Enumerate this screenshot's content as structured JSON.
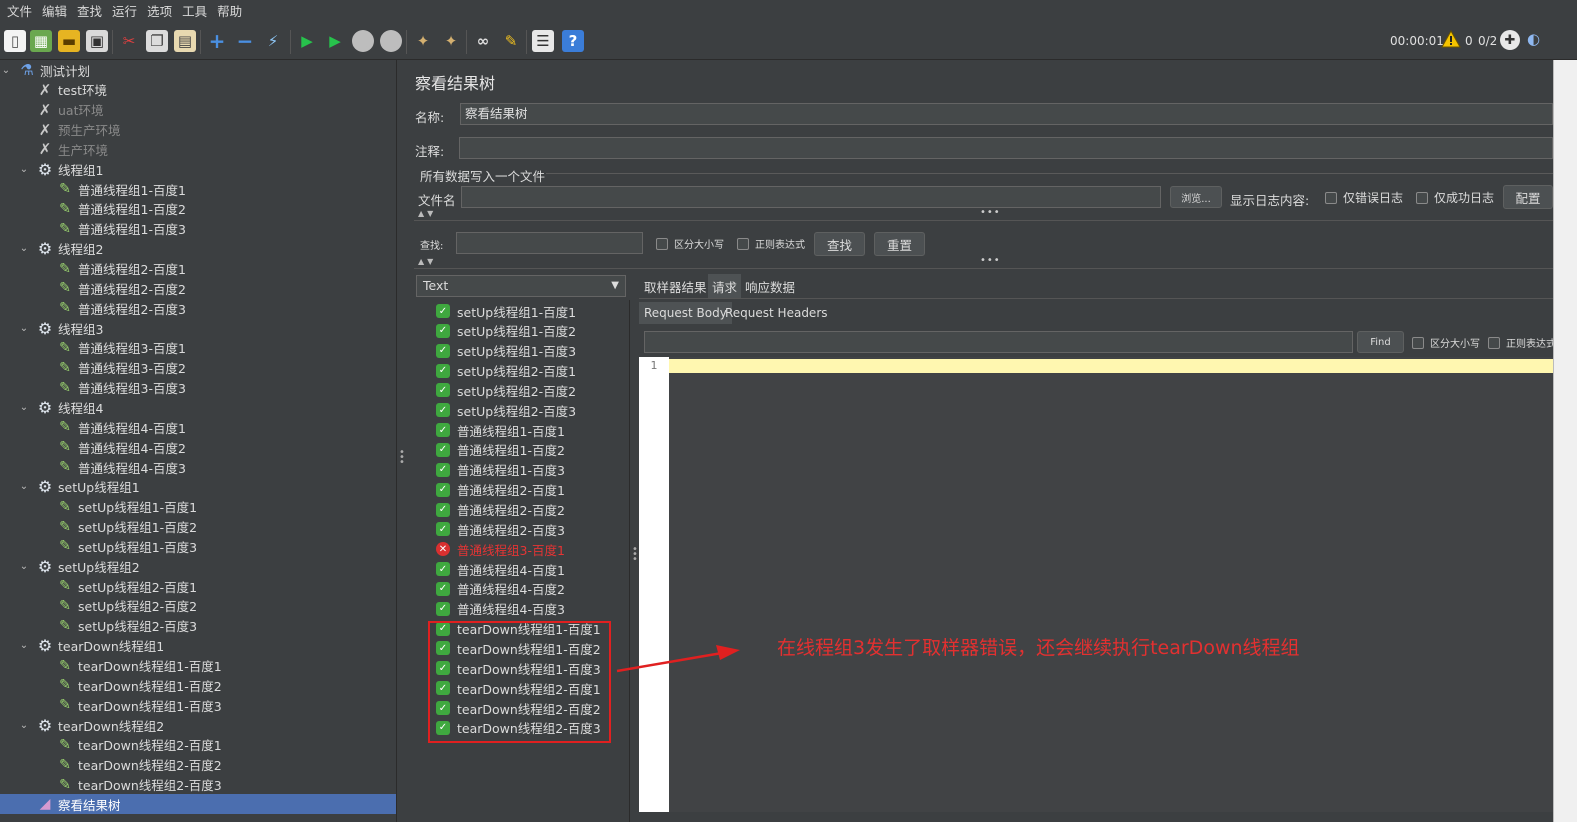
{
  "menu": [
    "文件",
    "编辑",
    "查找",
    "运行",
    "选项",
    "工具",
    "帮助"
  ],
  "status": {
    "time": "00:00:01",
    "error_count": "0",
    "threads": "0/2"
  },
  "tree": [
    {
      "label": "测试计划",
      "icon": "flask-icon",
      "level": 0,
      "expand": true
    },
    {
      "label": "test环境",
      "icon": "wrench-icon",
      "level": 1
    },
    {
      "label": "uat环境",
      "icon": "wrench-icon",
      "level": 1,
      "disabled": true
    },
    {
      "label": "预生产环境",
      "icon": "wrench-icon",
      "level": 1,
      "disabled": true
    },
    {
      "label": "生产环境",
      "icon": "wrench-icon",
      "level": 1,
      "disabled": true
    },
    {
      "label": "线程组1",
      "icon": "gear-icon",
      "level": 1,
      "expand": true
    },
    {
      "label": "普通线程组1-百度1",
      "icon": "pen-icon",
      "level": 2
    },
    {
      "label": "普通线程组1-百度2",
      "icon": "pen-icon",
      "level": 2
    },
    {
      "label": "普通线程组1-百度3",
      "icon": "pen-icon",
      "level": 2
    },
    {
      "label": "线程组2",
      "icon": "gear-icon",
      "level": 1,
      "expand": true
    },
    {
      "label": "普通线程组2-百度1",
      "icon": "pen-icon",
      "level": 2
    },
    {
      "label": "普通线程组2-百度2",
      "icon": "pen-icon",
      "level": 2
    },
    {
      "label": "普通线程组2-百度3",
      "icon": "pen-icon",
      "level": 2
    },
    {
      "label": "线程组3",
      "icon": "gear-icon",
      "level": 1,
      "expand": true
    },
    {
      "label": "普通线程组3-百度1",
      "icon": "pen-icon",
      "level": 2
    },
    {
      "label": "普通线程组3-百度2",
      "icon": "pen-icon",
      "level": 2
    },
    {
      "label": "普通线程组3-百度3",
      "icon": "pen-icon",
      "level": 2
    },
    {
      "label": "线程组4",
      "icon": "gear-icon",
      "level": 1,
      "expand": true
    },
    {
      "label": "普通线程组4-百度1",
      "icon": "pen-icon",
      "level": 2
    },
    {
      "label": "普通线程组4-百度2",
      "icon": "pen-icon",
      "level": 2
    },
    {
      "label": "普通线程组4-百度3",
      "icon": "pen-icon",
      "level": 2
    },
    {
      "label": "setUp线程组1",
      "icon": "gear-icon",
      "level": 1,
      "expand": true
    },
    {
      "label": "setUp线程组1-百度1",
      "icon": "pen-icon",
      "level": 2
    },
    {
      "label": "setUp线程组1-百度2",
      "icon": "pen-icon",
      "level": 2
    },
    {
      "label": "setUp线程组1-百度3",
      "icon": "pen-icon",
      "level": 2
    },
    {
      "label": "setUp线程组2",
      "icon": "gear-icon",
      "level": 1,
      "expand": true
    },
    {
      "label": "setUp线程组2-百度1",
      "icon": "pen-icon",
      "level": 2
    },
    {
      "label": "setUp线程组2-百度2",
      "icon": "pen-icon",
      "level": 2
    },
    {
      "label": "setUp线程组2-百度3",
      "icon": "pen-icon",
      "level": 2
    },
    {
      "label": "tearDown线程组1",
      "icon": "gear-icon",
      "level": 1,
      "expand": true
    },
    {
      "label": "tearDown线程组1-百度1",
      "icon": "pen-icon",
      "level": 2
    },
    {
      "label": "tearDown线程组1-百度2",
      "icon": "pen-icon",
      "level": 2
    },
    {
      "label": "tearDown线程组1-百度3",
      "icon": "pen-icon",
      "level": 2
    },
    {
      "label": "tearDown线程组2",
      "icon": "gear-icon",
      "level": 1,
      "expand": true
    },
    {
      "label": "tearDown线程组2-百度1",
      "icon": "pen-icon",
      "level": 2
    },
    {
      "label": "tearDown线程组2-百度2",
      "icon": "pen-icon",
      "level": 2
    },
    {
      "label": "tearDown线程组2-百度3",
      "icon": "pen-icon",
      "level": 2
    },
    {
      "label": "察看结果树",
      "icon": "listener-icon",
      "level": 1,
      "selected": true
    }
  ],
  "panel": {
    "title": "察看结果树",
    "name_label": "名称:",
    "name_value": "察看结果树",
    "comment_label": "注释:",
    "file_section": "所有数据写入一个文件",
    "filename_label": "文件名",
    "browse": "浏览...",
    "log_label": "显示日志内容:",
    "errors_only": "仅错误日志",
    "success_only": "仅成功日志",
    "configure": "配置",
    "search_label": "查找:",
    "case_sensitive": "区分大小写",
    "regex": "正则表达式",
    "find_btn": "查找",
    "reset_btn": "重置",
    "renderer": "Text"
  },
  "results": [
    {
      "label": "setUp线程组1-百度1",
      "ok": true
    },
    {
      "label": "setUp线程组1-百度2",
      "ok": true
    },
    {
      "label": "setUp线程组1-百度3",
      "ok": true
    },
    {
      "label": "setUp线程组2-百度1",
      "ok": true
    },
    {
      "label": "setUp线程组2-百度2",
      "ok": true
    },
    {
      "label": "setUp线程组2-百度3",
      "ok": true
    },
    {
      "label": "普通线程组1-百度1",
      "ok": true
    },
    {
      "label": "普通线程组1-百度2",
      "ok": true
    },
    {
      "label": "普通线程组1-百度3",
      "ok": true
    },
    {
      "label": "普通线程组2-百度1",
      "ok": true
    },
    {
      "label": "普通线程组2-百度2",
      "ok": true
    },
    {
      "label": "普通线程组2-百度3",
      "ok": true
    },
    {
      "label": "普通线程组3-百度1",
      "ok": false
    },
    {
      "label": "普通线程组4-百度1",
      "ok": true
    },
    {
      "label": "普通线程组4-百度2",
      "ok": true
    },
    {
      "label": "普通线程组4-百度3",
      "ok": true
    },
    {
      "label": "tearDown线程组1-百度1",
      "ok": true
    },
    {
      "label": "tearDown线程组1-百度2",
      "ok": true
    },
    {
      "label": "tearDown线程组1-百度3",
      "ok": true
    },
    {
      "label": "tearDown线程组2-百度1",
      "ok": true
    },
    {
      "label": "tearDown线程组2-百度2",
      "ok": true
    },
    {
      "label": "tearDown线程组2-百度3",
      "ok": true
    }
  ],
  "detail": {
    "tabs": [
      "取样器结果",
      "请求",
      "响应数据"
    ],
    "subtabs": [
      "Request Body",
      "Request Headers"
    ],
    "find_btn": "Find",
    "case_sensitive": "区分大小写",
    "regex": "正则表达式",
    "line_number": "1"
  },
  "annotation": "在线程组3发生了取样器错误，还会继续执行tearDown线程组",
  "colors": {
    "accent": "#4b6eaf",
    "annotation": "#e02020",
    "ok": "#3fa83f",
    "fail": "#d93030"
  }
}
